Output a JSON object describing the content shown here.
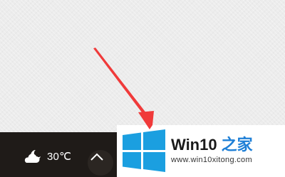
{
  "taskbar": {
    "weather_icon": "cloudy-night-icon",
    "temperature": "30℃",
    "tray_expand_icon": "chevron-up-icon"
  },
  "watermark": {
    "logo_icon": "windows-logo-icon",
    "title": "Win10",
    "title_cn": "之家",
    "url": "www.win10xitong.com"
  },
  "annotation": {
    "type": "red-arrow",
    "color": "#f03a3a"
  },
  "colors": {
    "taskbar": "#1f1b18",
    "windows_blue": "#1b9fe0",
    "brand_blue": "#1e7fd6"
  }
}
